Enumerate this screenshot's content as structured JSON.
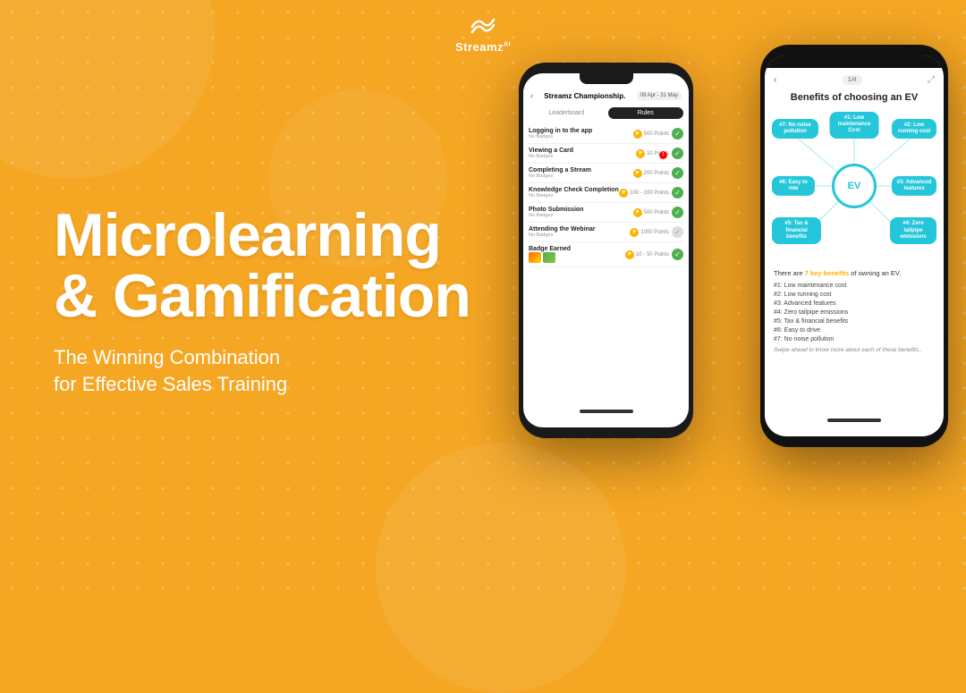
{
  "brand": {
    "name": "Streamz",
    "superscript": "AI",
    "logo_alt": "Streamz AI logo"
  },
  "hero": {
    "title_line1": "Microlearning",
    "title_line2": "& Gamification",
    "subtitle_line1": "The Winning Combination",
    "subtitle_line2": "for Effective Sales Training"
  },
  "phone1": {
    "back_label": "‹",
    "title": "Streamz Championship.",
    "date_badge": "09 Apr - 31 May",
    "tabs": [
      "Leaderboard",
      "Rules"
    ],
    "active_tab": "Rules",
    "rules": [
      {
        "name": "Logging in to the app",
        "badges": "No Badges",
        "points": "500 Points",
        "done": true
      },
      {
        "name": "Viewing a Card",
        "badges": "No Badges",
        "points": "10 Points",
        "done": true,
        "notif": true
      },
      {
        "name": "Completing a Stream",
        "badges": "No Badges",
        "points": "200 Points",
        "done": true
      },
      {
        "name": "Knowledge Check Completion",
        "badges": "No Badges",
        "points": "100 - 200 Points",
        "done": true
      },
      {
        "name": "Photo Submission",
        "badges": "No Badges",
        "points": "500 Points",
        "done": true
      },
      {
        "name": "Attending the Webinar",
        "badges": "No Badges",
        "points": "1000 Points",
        "done": false
      },
      {
        "name": "Badge Earned",
        "badges": "",
        "points": "10 - 50 Points",
        "done": true,
        "is_badge": true
      }
    ]
  },
  "phone2": {
    "back_label": "‹",
    "progress": "1/4",
    "title": "Benefits of choosing an EV",
    "ev_center_label": "EV",
    "nodes": [
      {
        "id": "top",
        "label": "#1: Low maintenance Cost",
        "position": "top"
      },
      {
        "id": "top-right",
        "label": "#2: Low running cost",
        "position": "top-right"
      },
      {
        "id": "right",
        "label": "#3: Advanced features",
        "position": "right"
      },
      {
        "id": "bot-right",
        "label": "#4: Zero tailpipe emissions",
        "position": "bot-right"
      },
      {
        "id": "bot-left",
        "label": "#5: Tax & financial benefits",
        "position": "bot-left"
      },
      {
        "id": "left",
        "label": "#6: Easy to ride",
        "position": "left"
      },
      {
        "id": "top-left",
        "label": "#7: No noise pollution",
        "position": "top-left"
      }
    ],
    "intro_text": "There are ",
    "key_count": "7 key benefits",
    "intro_text2": " of owning an EV.",
    "benefits": [
      "#1: Low maintenance cost",
      "#2: Low running cost",
      "#3: Advanced features",
      "#4: Zero tailpipe emissions",
      "#5: Tax & financial benefits",
      "#6: Easy to drive",
      "#7: No noise pollution"
    ],
    "swipe_note": "Swipe ahead to know more about each of these benefits.."
  }
}
